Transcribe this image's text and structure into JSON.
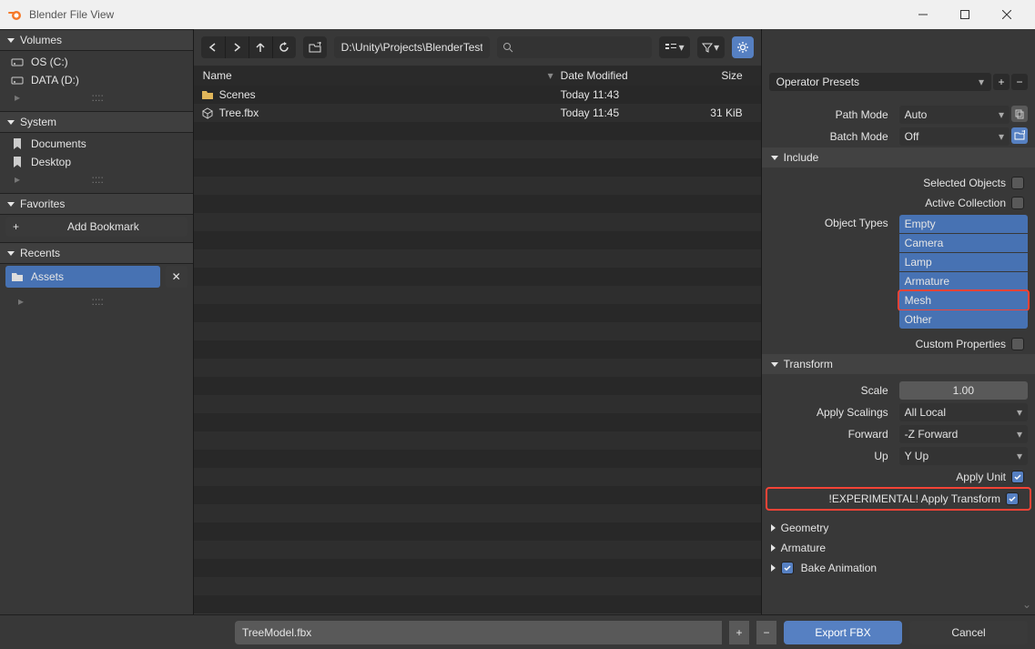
{
  "window": {
    "title": "Blender File View"
  },
  "sidebar": {
    "volumes_header": "Volumes",
    "volumes": [
      {
        "label": "OS (C:)"
      },
      {
        "label": "DATA (D:)"
      }
    ],
    "system_header": "System",
    "system": [
      {
        "label": "Documents"
      },
      {
        "label": "Desktop"
      }
    ],
    "favorites_header": "Favorites",
    "add_bookmark_label": "Add Bookmark",
    "recents_header": "Recents",
    "recents": [
      {
        "label": "Assets"
      }
    ]
  },
  "toolbar": {
    "path": "D:\\Unity\\Projects\\BlenderTest\\Assets\\",
    "search_placeholder": ""
  },
  "filecols": {
    "name": "Name",
    "date": "Date Modified",
    "size": "Size"
  },
  "files": [
    {
      "name": "Scenes",
      "date": "Today 11:43",
      "size": "",
      "kind": "folder"
    },
    {
      "name": "Tree.fbx",
      "date": "Today 11:45",
      "size": "31 KiB",
      "kind": "file"
    }
  ],
  "options": {
    "presets_label": "Operator Presets",
    "path_mode_label": "Path Mode",
    "path_mode_value": "Auto",
    "batch_mode_label": "Batch Mode",
    "batch_mode_value": "Off",
    "include_header": "Include",
    "selected_objects_label": "Selected Objects",
    "active_collection_label": "Active Collection",
    "object_types_label": "Object Types",
    "object_types": [
      "Empty",
      "Camera",
      "Lamp",
      "Armature",
      "Mesh",
      "Other"
    ],
    "object_types_selected_index": 4,
    "custom_props_label": "Custom Properties",
    "transform_header": "Transform",
    "scale_label": "Scale",
    "scale_value": "1.00",
    "apply_scalings_label": "Apply Scalings",
    "apply_scalings_value": "All Local",
    "forward_label": "Forward",
    "forward_value": "-Z Forward",
    "up_label": "Up",
    "up_value": "Y Up",
    "apply_unit_label": "Apply Unit",
    "apply_transform_label": "!EXPERIMENTAL! Apply Transform",
    "geometry_header": "Geometry",
    "armature_header": "Armature",
    "bake_anim_header": "Bake Animation"
  },
  "bottom": {
    "filename": "TreeModel.fbx",
    "export_label": "Export FBX",
    "cancel_label": "Cancel"
  }
}
